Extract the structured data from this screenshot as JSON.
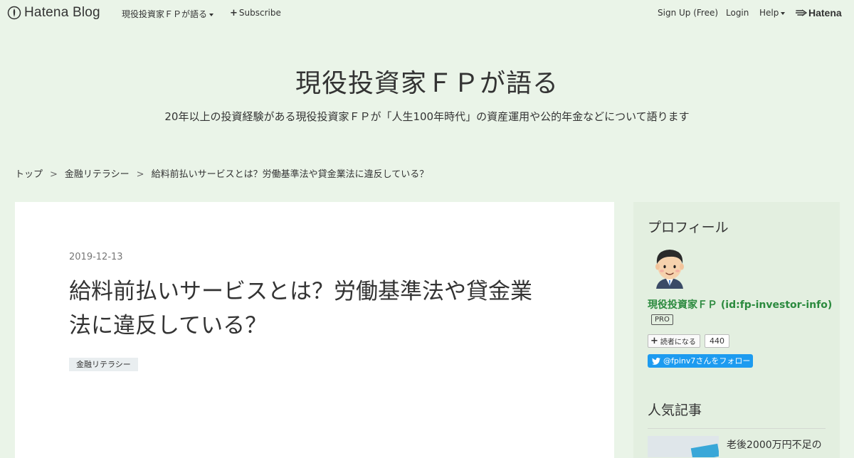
{
  "globalbar": {
    "logo_text": "Hatena Blog",
    "blog_name": "現役投資家ＦＰが語る",
    "subscribe_label": "Subscribe",
    "signup_label": "Sign Up (Free)",
    "login_label": "Login",
    "help_label": "Help",
    "hatena_label": "Hatena"
  },
  "header": {
    "title": "現役投資家ＦＰが語る",
    "description": "20年以上の投資経験がある現役投資家ＦＰが「人生100年時代」の資産運用や公的年金などについて語ります"
  },
  "breadcrumb": {
    "items": [
      "トップ",
      "金融リテラシー",
      "給料前払いサービスとは？労働基準法や貸金業法に違反している？"
    ],
    "separator": ">"
  },
  "article": {
    "date": "2019-12-13",
    "title_line1": "給料前払いサービスとは？労働基準法や貸金業",
    "title_line2": "法に違反している？",
    "category": "金融リテラシー"
  },
  "sidebar": {
    "profile_heading": "プロフィール",
    "profile_name": "現役投資家ＦＰ (id:fp-investor-info)",
    "pro_badge": "PRO",
    "reader_button": "読者になる",
    "reader_count": "440",
    "twitter_button": "@fpinv7さんをフォロー",
    "popular_heading": "人気記事",
    "popular_item_title": "老後2000万円不足の"
  },
  "colors": {
    "background": "#eaf4e8",
    "card": "#ffffff",
    "sidebar": "#e3efe0",
    "profile_name": "#2b8a3e",
    "twitter": "#1d9bf0"
  },
  "icons": [
    "hatena-blog-logo-icon",
    "caret-down-icon",
    "plus-icon",
    "hatena-logo-icon",
    "twitter-bird-icon"
  ]
}
